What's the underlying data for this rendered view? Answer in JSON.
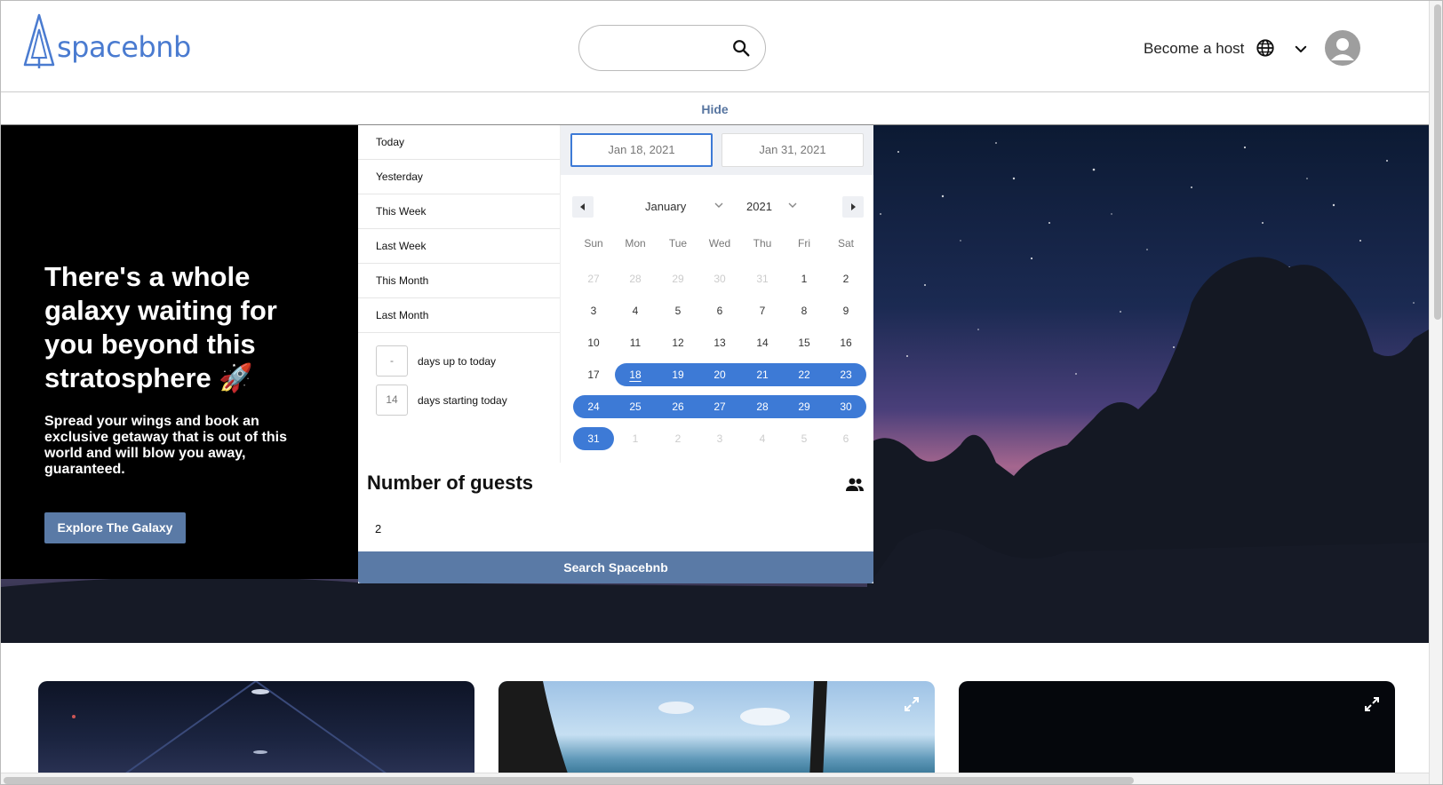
{
  "header": {
    "logo_text": "spacebnb",
    "search_placeholder": "",
    "become_host": "Become a host",
    "icons": {
      "search": "search-icon",
      "globe": "globe-icon",
      "chevron": "chevron-down-icon",
      "avatar": "user-avatar-icon"
    }
  },
  "hide_bar": {
    "label": "Hide"
  },
  "hero": {
    "headline": "There's a whole galaxy waiting for you beyond this stratosphere 🚀",
    "subline": "Spread your wings and book an exclusive getaway that is out of this world and will blow you away, guaranteed.",
    "cta": "Explore The Galaxy"
  },
  "picker": {
    "presets": [
      "Today",
      "Yesterday",
      "This Week",
      "Last Week",
      "This Month",
      "Last Month"
    ],
    "days_up_value": "-",
    "days_up_label": "days up to today",
    "days_start_value": "14",
    "days_start_label": "days starting today",
    "start_date": "Jan 18, 2021",
    "end_date": "Jan 31, 2021",
    "month": "January",
    "year": "2021",
    "weekdays": [
      "Sun",
      "Mon",
      "Tue",
      "Wed",
      "Thu",
      "Fri",
      "Sat"
    ],
    "weeks": [
      [
        "27",
        "28",
        "29",
        "30",
        "31",
        "1",
        "2"
      ],
      [
        "3",
        "4",
        "5",
        "6",
        "7",
        "8",
        "9"
      ],
      [
        "10",
        "11",
        "12",
        "13",
        "14",
        "15",
        "16"
      ],
      [
        "17",
        "18",
        "19",
        "20",
        "21",
        "22",
        "23"
      ],
      [
        "24",
        "25",
        "26",
        "27",
        "28",
        "29",
        "30"
      ],
      [
        "31",
        "1",
        "2",
        "3",
        "4",
        "5",
        "6"
      ]
    ],
    "selected_range": {
      "start": "18",
      "end": "31"
    },
    "accent_color": "#3d7ad6",
    "guests_title": "Number of guests",
    "guests_value": "2",
    "search_button": "Search Spacebnb"
  },
  "colors": {
    "brand_button": "#5a7aa6",
    "logo": "#4a7bd0"
  }
}
